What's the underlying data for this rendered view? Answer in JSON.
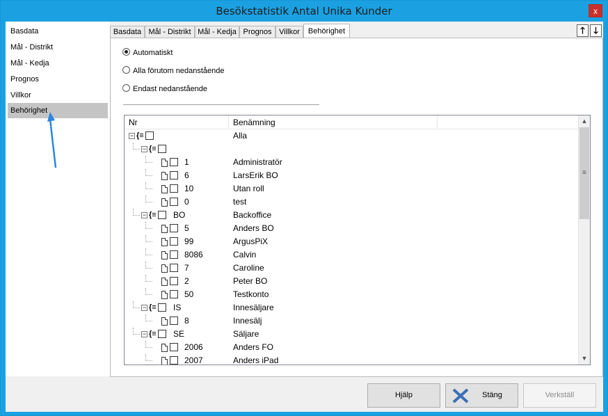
{
  "window": {
    "title": "Besökstatistik Antal Unika Kunder",
    "close_glyph": "x"
  },
  "sidebar": {
    "items": [
      {
        "label": "Basdata"
      },
      {
        "label": "Mål - Distrikt"
      },
      {
        "label": "Mål - Kedja"
      },
      {
        "label": "Prognos"
      },
      {
        "label": "Villkor"
      },
      {
        "label": "Behörighet",
        "active": true
      }
    ]
  },
  "tabs": [
    {
      "label": "Basdata"
    },
    {
      "label": "Mål - Distrikt"
    },
    {
      "label": "Mål - Kedja"
    },
    {
      "label": "Prognos"
    },
    {
      "label": "Villkor"
    },
    {
      "label": "Behörighet",
      "active": true
    }
  ],
  "nav": {
    "up": "🡑",
    "down": "🡓"
  },
  "options": {
    "radios": [
      {
        "label": "Automatiskt",
        "checked": true
      },
      {
        "label": "Alla förutom nedanstående",
        "checked": false
      },
      {
        "label": "Endast nedanstående",
        "checked": false
      }
    ]
  },
  "grid": {
    "columns": [
      "Nr",
      "Benämning"
    ],
    "rows": [
      {
        "level": 0,
        "kind": "group",
        "nr": "",
        "name": "Alla"
      },
      {
        "level": 1,
        "kind": "group",
        "nr": "",
        "name": ""
      },
      {
        "level": 2,
        "kind": "item",
        "nr": "1",
        "name": "Administratör"
      },
      {
        "level": 2,
        "kind": "item",
        "nr": "6",
        "name": "LarsErik BO"
      },
      {
        "level": 2,
        "kind": "item",
        "nr": "10",
        "name": "Utan roll"
      },
      {
        "level": 2,
        "kind": "item",
        "nr": "0",
        "name": "test"
      },
      {
        "level": 1,
        "kind": "group",
        "nr": "BO",
        "name": "Backoffice"
      },
      {
        "level": 2,
        "kind": "item",
        "nr": "5",
        "name": "Anders BO"
      },
      {
        "level": 2,
        "kind": "item",
        "nr": "99",
        "name": "ArgusPiX"
      },
      {
        "level": 2,
        "kind": "item",
        "nr": "8086",
        "name": "Calvin"
      },
      {
        "level": 2,
        "kind": "item",
        "nr": "7",
        "name": "Caroline"
      },
      {
        "level": 2,
        "kind": "item",
        "nr": "2",
        "name": "Peter BO"
      },
      {
        "level": 2,
        "kind": "item",
        "nr": "50",
        "name": "Testkonto"
      },
      {
        "level": 1,
        "kind": "group",
        "nr": "IS",
        "name": "Innesäljare"
      },
      {
        "level": 2,
        "kind": "item",
        "nr": "8",
        "name": "Innesälj"
      },
      {
        "level": 1,
        "kind": "group",
        "nr": "SE",
        "name": "Säljare"
      },
      {
        "level": 2,
        "kind": "item",
        "nr": "2006",
        "name": "Anders FO"
      },
      {
        "level": 2,
        "kind": "item",
        "nr": "2007",
        "name": "Anders iPad"
      }
    ],
    "expander_glyph": "−",
    "folder_glyph": "{≡",
    "scroll_up": "▲",
    "scroll_down": "▼",
    "thumb_glyph": "≡"
  },
  "footer": {
    "help_label": "Hjälp",
    "close_label": "Stäng",
    "apply_label": "Verkställ"
  },
  "colors": {
    "titlebar": "#1ba1e2",
    "active_sidebar": "#c4c4c4",
    "arrow": "#2b86e0",
    "close_x": "#3a6fb5"
  }
}
